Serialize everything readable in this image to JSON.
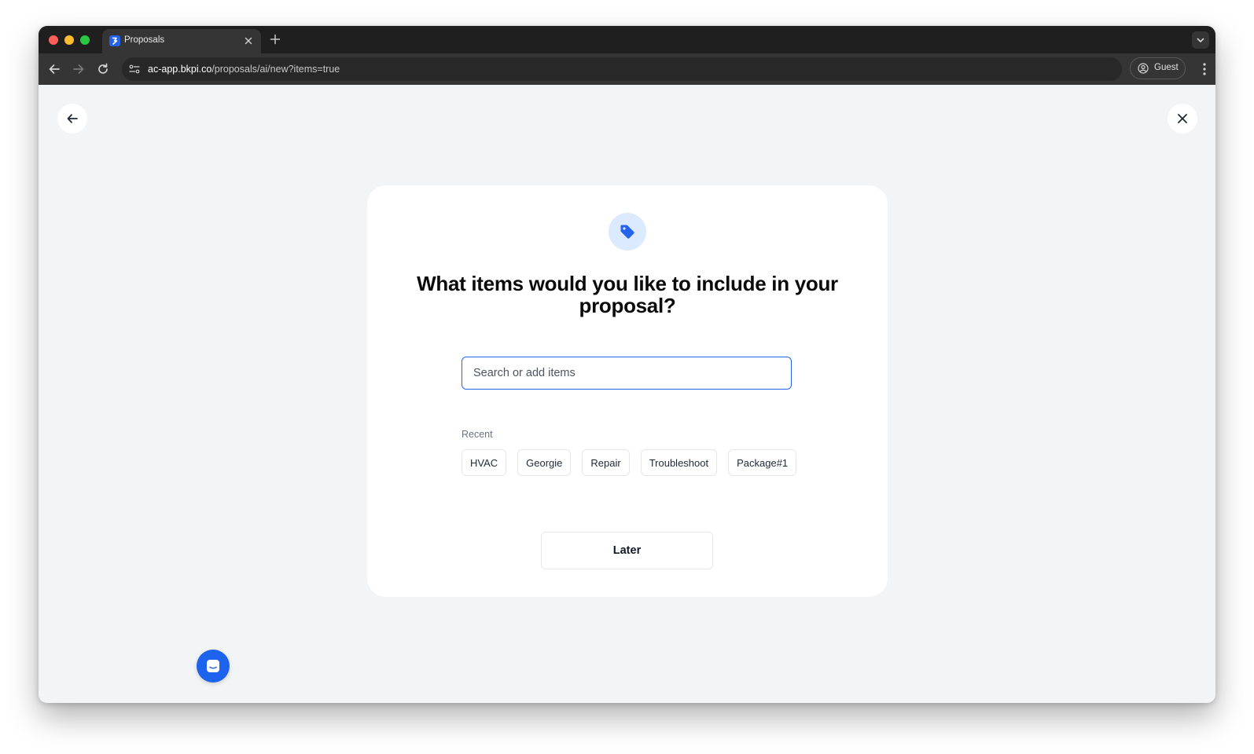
{
  "colors": {
    "accent": "#2563eb",
    "traffic_close": "#ff5f57",
    "traffic_minimize": "#febc2e",
    "traffic_zoom": "#28c840",
    "badge_background": "#dbeafe",
    "page_background": "#f3f4f6"
  },
  "browser": {
    "tab": {
      "title": "Proposals",
      "favicon": "proposals-favicon-icon"
    },
    "url": {
      "host": "ac-app.bkpi.co",
      "path": "/proposals/ai/new?items=true"
    },
    "profile_label": "Guest"
  },
  "page": {
    "back_icon": "arrow-left-icon",
    "close_icon": "close-icon",
    "badge_icon": "tag-icon",
    "question": "What items would you like to include in your proposal?",
    "search": {
      "placeholder": "Search or add items",
      "value": ""
    },
    "recent": {
      "label": "Recent",
      "items": [
        "HVAC",
        "Georgie",
        "Repair",
        "Troubleshoot",
        "Package#1"
      ]
    },
    "later_label": "Later",
    "chat_icon": "chat-launcher-icon"
  }
}
